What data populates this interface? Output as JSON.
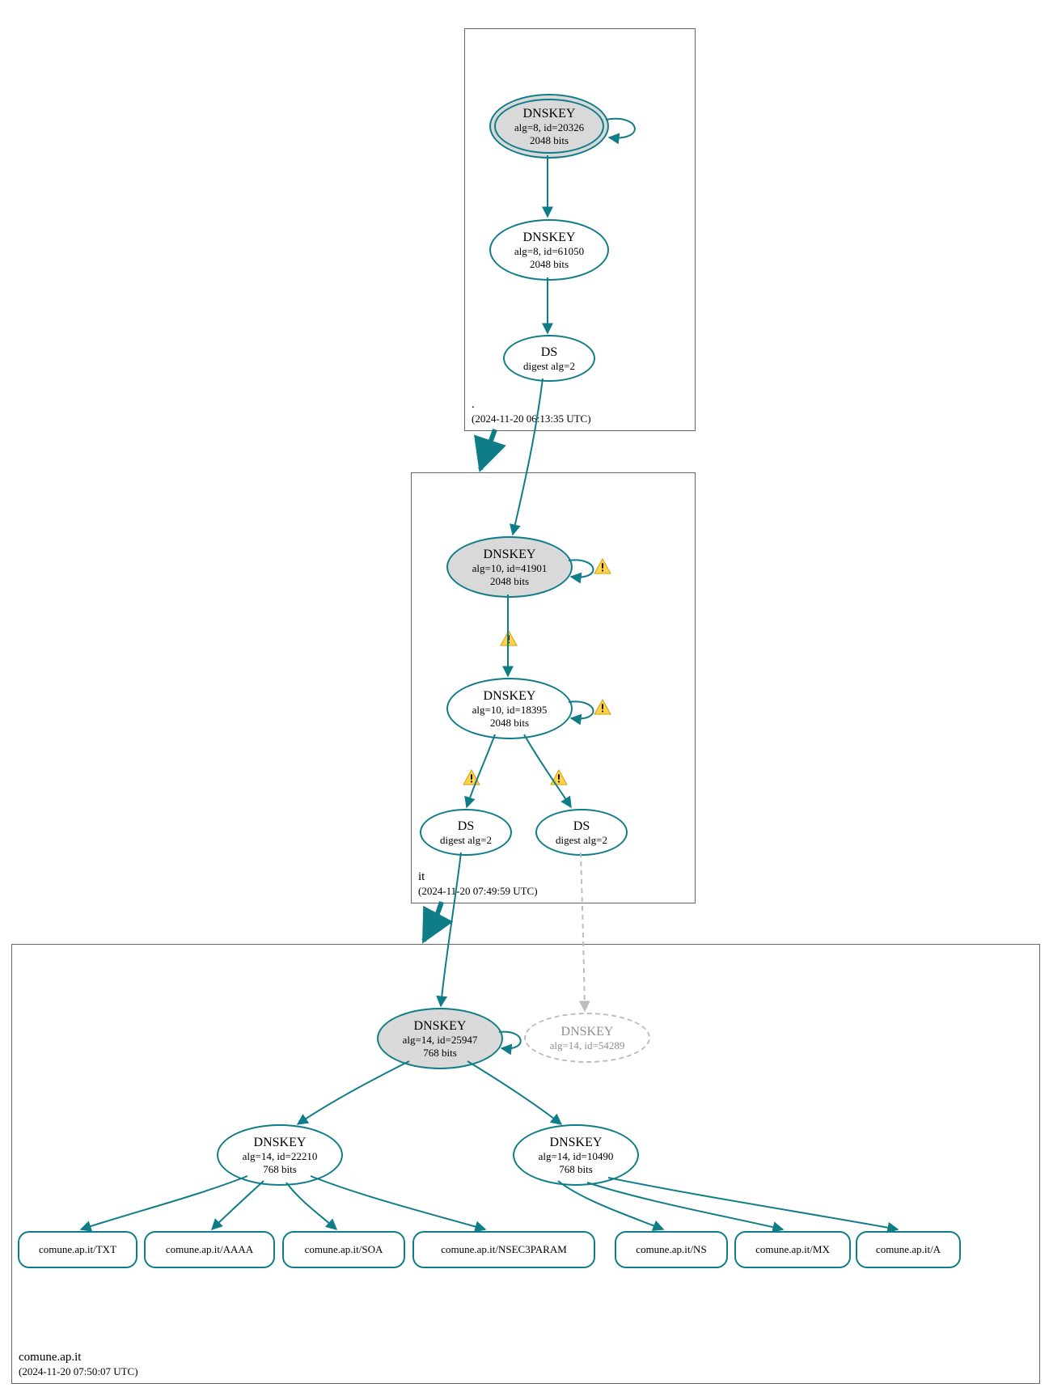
{
  "zones": {
    "root": {
      "name": ".",
      "timestamp": "(2024-11-20 06:13:35 UTC)",
      "nodes": {
        "ksk": {
          "title": "DNSKEY",
          "line2": "alg=8, id=20326",
          "line3": "2048 bits"
        },
        "zsk": {
          "title": "DNSKEY",
          "line2": "alg=8, id=61050",
          "line3": "2048 bits"
        },
        "ds": {
          "title": "DS",
          "line2": "digest alg=2"
        }
      }
    },
    "it": {
      "name": "it",
      "timestamp": "(2024-11-20 07:49:59 UTC)",
      "nodes": {
        "ksk": {
          "title": "DNSKEY",
          "line2": "alg=10, id=41901",
          "line3": "2048 bits"
        },
        "zsk": {
          "title": "DNSKEY",
          "line2": "alg=10, id=18395",
          "line3": "2048 bits"
        },
        "ds1": {
          "title": "DS",
          "line2": "digest alg=2"
        },
        "ds2": {
          "title": "DS",
          "line2": "digest alg=2"
        }
      }
    },
    "domain": {
      "name": "comune.ap.it",
      "timestamp": "(2024-11-20 07:50:07 UTC)",
      "nodes": {
        "ksk": {
          "title": "DNSKEY",
          "line2": "alg=14, id=25947",
          "line3": "768 bits"
        },
        "ghost": {
          "title": "DNSKEY",
          "line2": "alg=14, id=54289"
        },
        "zsk1": {
          "title": "DNSKEY",
          "line2": "alg=14, id=22210",
          "line3": "768 bits"
        },
        "zsk2": {
          "title": "DNSKEY",
          "line2": "alg=14, id=10490",
          "line3": "768 bits"
        }
      },
      "rrsets": {
        "txt": "comune.ap.it/TXT",
        "aaaa": "comune.ap.it/AAAA",
        "soa": "comune.ap.it/SOA",
        "nsec3": "comune.ap.it/NSEC3PARAM",
        "ns": "comune.ap.it/NS",
        "mx": "comune.ap.it/MX",
        "a": "comune.ap.it/A"
      }
    }
  }
}
